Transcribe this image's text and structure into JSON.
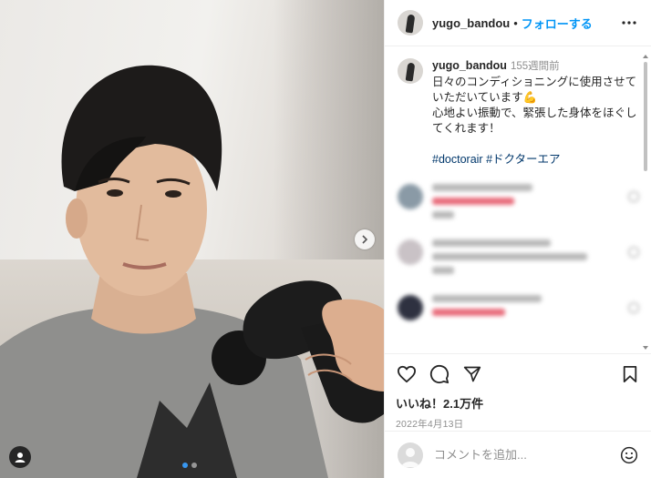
{
  "post": {
    "username": "yugo_bandou",
    "separator": "•",
    "follow_label": "フォローする",
    "caption": {
      "username": "yugo_bandou",
      "time": "155週間前",
      "line1": "日々のコンディショニングに使用させていただいています💪",
      "line2": "心地よい振動で、緊張した身体をほぐしてくれます！",
      "hashtag1": "#doctorair",
      "hashtag2": "#ドクターエア"
    },
    "likes": "いいね！2.1万件",
    "date": "2022年4月13日",
    "comment_placeholder": "コメントを追加...",
    "carousel": {
      "total_slides": 2,
      "active_slide": 1
    }
  },
  "colors": {
    "accent": "#0095f6",
    "active_dot": "#3897f0",
    "text": "#262626",
    "muted": "#8e8e8e"
  },
  "icons": [
    "more-horizontal-icon",
    "chevron-right-icon",
    "user-tag-icon",
    "heart-icon",
    "comment-icon",
    "share-icon",
    "bookmark-icon",
    "emoji-icon"
  ]
}
